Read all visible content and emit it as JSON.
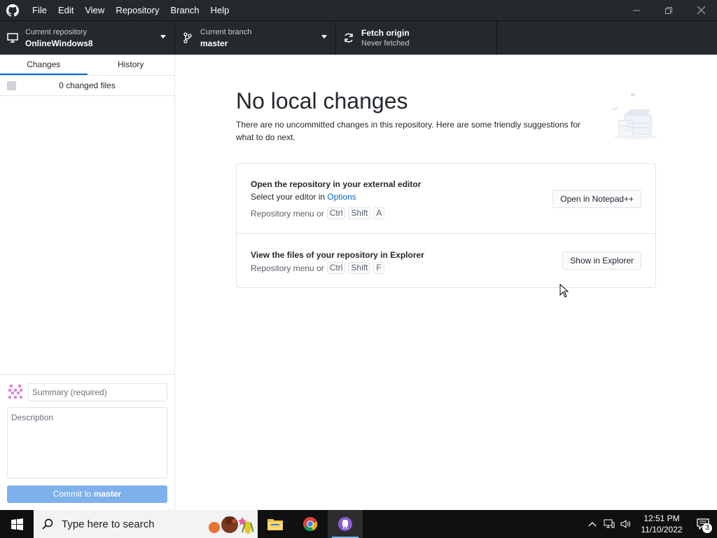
{
  "menu": {
    "items": [
      "File",
      "Edit",
      "View",
      "Repository",
      "Branch",
      "Help"
    ]
  },
  "toolbar": {
    "repo": {
      "label": "Current repository",
      "value": "OnlineWindows8"
    },
    "branch": {
      "label": "Current branch",
      "value": "master"
    },
    "fetch": {
      "label": "Fetch origin",
      "value": "Never fetched"
    }
  },
  "sidebar": {
    "tabs": [
      "Changes",
      "History"
    ],
    "changes_count": "0 changed files",
    "summary_placeholder": "Summary (required)",
    "description_placeholder": "Description",
    "commit_prefix": "Commit to",
    "commit_branch": "master"
  },
  "main": {
    "heading": "No local changes",
    "intro": "There are no uncommitted changes in this repository. Here are some friendly suggestions for what to do next.",
    "suggestions": [
      {
        "title": "Open the repository in your external editor",
        "line_prefix": "Select your editor in",
        "line_link": "Options",
        "shortcut_prefix": "Repository menu or",
        "keys": [
          "Ctrl",
          "Shift",
          "A"
        ],
        "button": "Open in Notepad++"
      },
      {
        "title": "View the files of your repository in Explorer",
        "shortcut_prefix": "Repository menu or",
        "keys": [
          "Ctrl",
          "Shift",
          "F"
        ],
        "button": "Show in Explorer"
      }
    ]
  },
  "taskbar": {
    "search_placeholder": "Type here to search",
    "time": "12:51 PM",
    "date": "11/10/2022",
    "notification_count": "3"
  },
  "colors": {
    "toolbar_bg": "#24292e",
    "accent_blue": "#0366d6",
    "commit_button_disabled": "#7eb1ec",
    "taskbar_bg": "#101010"
  },
  "icons": [
    "github-logo-icon",
    "minimize-icon",
    "maximize-icon",
    "close-icon",
    "monitor-icon",
    "branch-icon",
    "sync-icon",
    "windows-start-icon",
    "search-icon",
    "file-explorer-icon",
    "chrome-icon",
    "github-desktop-icon",
    "chevron-up-icon",
    "network-icon",
    "volume-icon",
    "notification-icon"
  ]
}
